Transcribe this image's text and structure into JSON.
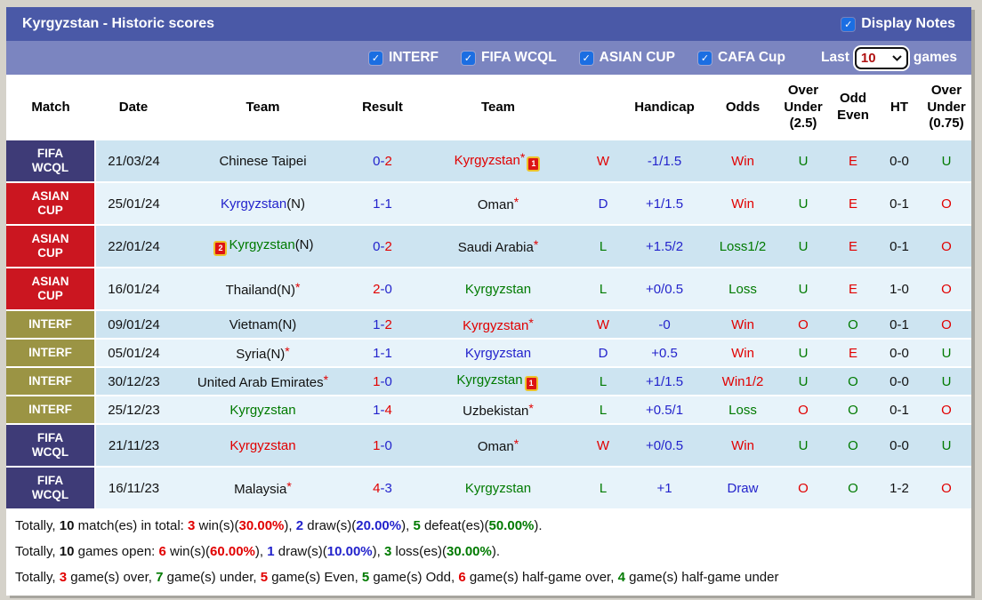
{
  "colors": {
    "red": "#e10000",
    "blue": "#2323cc",
    "green": "#007a00",
    "black": "#111111",
    "title_bar_bg": "#4a59a7",
    "filter_bar_bg": "#7b85c0",
    "row_dark": "#cde4f1",
    "row_light": "#e7f3fa",
    "comp_fifa_bg": "#3e3b77",
    "comp_asian_bg": "#cb1620",
    "comp_interf_bg": "#9b9444",
    "checkbox_blue": "#1b6ee2",
    "select_value_color": "#b01212"
  },
  "title_bar": {
    "title": "Kyrgyzstan - Historic scores",
    "display_notes_label": "Display Notes",
    "display_notes_checked": true
  },
  "filter_bar": {
    "competitions": [
      {
        "label": "INTERF",
        "checked": true
      },
      {
        "label": "FIFA WCQL",
        "checked": true
      },
      {
        "label": "ASIAN CUP",
        "checked": true
      },
      {
        "label": "CAFA Cup",
        "checked": true
      }
    ],
    "last_label": "Last",
    "selected_games": "10",
    "games_label": "games"
  },
  "table": {
    "columns": [
      "Match",
      "Date",
      "Team",
      "Result",
      "Team",
      "",
      "Handicap",
      "Odds",
      "Over Under (2.5)",
      "Odd Even",
      "HT",
      "Over Under (0.75)"
    ],
    "rows": [
      {
        "competition": "FIFA WCQL",
        "comp_key": "fifa",
        "date": "21/03/24",
        "home": {
          "name": "Chinese Taipei",
          "suffix": "",
          "color": "black",
          "star": false,
          "card": null
        },
        "score": {
          "home": "0",
          "away": "2",
          "home_color": "blue",
          "away_color": "red"
        },
        "away": {
          "name": "Kyrgyzstan",
          "suffix": "",
          "color": "red",
          "star": true,
          "card": {
            "count": "1",
            "pos": "after"
          }
        },
        "wdl": {
          "t": "W",
          "c": "red"
        },
        "handicap": "-1/1.5",
        "odds": {
          "t": "Win",
          "c": "red"
        },
        "ou25": {
          "t": "U",
          "c": "green"
        },
        "odd_even": {
          "t": "E",
          "c": "red"
        },
        "ht": "0-0",
        "ou075": {
          "t": "U",
          "c": "green"
        }
      },
      {
        "competition": "ASIAN CUP",
        "comp_key": "asian",
        "date": "25/01/24",
        "home": {
          "name": "Kyrgyzstan",
          "suffix": "(N)",
          "color": "blue",
          "star": false,
          "card": null
        },
        "score": {
          "home": "1",
          "away": "1",
          "home_color": "blue",
          "away_color": "blue"
        },
        "away": {
          "name": "Oman",
          "suffix": "",
          "color": "black",
          "star": true,
          "card": null
        },
        "wdl": {
          "t": "D",
          "c": "blue"
        },
        "handicap": "+1/1.5",
        "odds": {
          "t": "Win",
          "c": "red"
        },
        "ou25": {
          "t": "U",
          "c": "green"
        },
        "odd_even": {
          "t": "E",
          "c": "red"
        },
        "ht": "0-1",
        "ou075": {
          "t": "O",
          "c": "red"
        }
      },
      {
        "competition": "ASIAN CUP",
        "comp_key": "asian",
        "date": "22/01/24",
        "home": {
          "name": "Kyrgyzstan",
          "suffix": "(N)",
          "color": "green",
          "star": false,
          "card": {
            "count": "2",
            "pos": "before"
          }
        },
        "score": {
          "home": "0",
          "away": "2",
          "home_color": "blue",
          "away_color": "red"
        },
        "away": {
          "name": "Saudi Arabia",
          "suffix": "",
          "color": "black",
          "star": true,
          "card": null
        },
        "wdl": {
          "t": "L",
          "c": "green"
        },
        "handicap": "+1.5/2",
        "odds": {
          "t": "Loss1/2",
          "c": "green"
        },
        "ou25": {
          "t": "U",
          "c": "green"
        },
        "odd_even": {
          "t": "E",
          "c": "red"
        },
        "ht": "0-1",
        "ou075": {
          "t": "O",
          "c": "red"
        }
      },
      {
        "competition": "ASIAN CUP",
        "comp_key": "asian",
        "date": "16/01/24",
        "home": {
          "name": "Thailand",
          "suffix": "(N)",
          "color": "black",
          "star": true,
          "card": null
        },
        "score": {
          "home": "2",
          "away": "0",
          "home_color": "red",
          "away_color": "blue"
        },
        "away": {
          "name": "Kyrgyzstan",
          "suffix": "",
          "color": "green",
          "star": false,
          "card": null
        },
        "wdl": {
          "t": "L",
          "c": "green"
        },
        "handicap": "+0/0.5",
        "odds": {
          "t": "Loss",
          "c": "green"
        },
        "ou25": {
          "t": "U",
          "c": "green"
        },
        "odd_even": {
          "t": "E",
          "c": "red"
        },
        "ht": "1-0",
        "ou075": {
          "t": "O",
          "c": "red"
        }
      },
      {
        "competition": "INTERF",
        "comp_key": "interf",
        "date": "09/01/24",
        "home": {
          "name": "Vietnam",
          "suffix": "(N)",
          "color": "black",
          "star": false,
          "card": null
        },
        "score": {
          "home": "1",
          "away": "2",
          "home_color": "blue",
          "away_color": "red"
        },
        "away": {
          "name": "Kyrgyzstan",
          "suffix": "",
          "color": "red",
          "star": true,
          "card": null
        },
        "wdl": {
          "t": "W",
          "c": "red"
        },
        "handicap": "-0",
        "odds": {
          "t": "Win",
          "c": "red"
        },
        "ou25": {
          "t": "O",
          "c": "red"
        },
        "odd_even": {
          "t": "O",
          "c": "green"
        },
        "ht": "0-1",
        "ou075": {
          "t": "O",
          "c": "red"
        }
      },
      {
        "competition": "INTERF",
        "comp_key": "interf",
        "date": "05/01/24",
        "home": {
          "name": "Syria",
          "suffix": "(N)",
          "color": "black",
          "star": true,
          "card": null
        },
        "score": {
          "home": "1",
          "away": "1",
          "home_color": "blue",
          "away_color": "blue"
        },
        "away": {
          "name": "Kyrgyzstan",
          "suffix": "",
          "color": "blue",
          "star": false,
          "card": null
        },
        "wdl": {
          "t": "D",
          "c": "blue"
        },
        "handicap": "+0.5",
        "odds": {
          "t": "Win",
          "c": "red"
        },
        "ou25": {
          "t": "U",
          "c": "green"
        },
        "odd_even": {
          "t": "E",
          "c": "red"
        },
        "ht": "0-0",
        "ou075": {
          "t": "U",
          "c": "green"
        }
      },
      {
        "competition": "INTERF",
        "comp_key": "interf",
        "date": "30/12/23",
        "home": {
          "name": "United Arab Emirates",
          "suffix": "",
          "color": "black",
          "star": true,
          "card": null
        },
        "score": {
          "home": "1",
          "away": "0",
          "home_color": "red",
          "away_color": "blue"
        },
        "away": {
          "name": "Kyrgyzstan",
          "suffix": "",
          "color": "green",
          "star": false,
          "card": {
            "count": "1",
            "pos": "after"
          }
        },
        "wdl": {
          "t": "L",
          "c": "green"
        },
        "handicap": "+1/1.5",
        "odds": {
          "t": "Win1/2",
          "c": "red"
        },
        "ou25": {
          "t": "U",
          "c": "green"
        },
        "odd_even": {
          "t": "O",
          "c": "green"
        },
        "ht": "0-0",
        "ou075": {
          "t": "U",
          "c": "green"
        }
      },
      {
        "competition": "INTERF",
        "comp_key": "interf",
        "date": "25/12/23",
        "home": {
          "name": "Kyrgyzstan",
          "suffix": "",
          "color": "green",
          "star": false,
          "card": null
        },
        "score": {
          "home": "1",
          "away": "4",
          "home_color": "blue",
          "away_color": "red"
        },
        "away": {
          "name": "Uzbekistan",
          "suffix": "",
          "color": "black",
          "star": true,
          "card": null
        },
        "wdl": {
          "t": "L",
          "c": "green"
        },
        "handicap": "+0.5/1",
        "odds": {
          "t": "Loss",
          "c": "green"
        },
        "ou25": {
          "t": "O",
          "c": "red"
        },
        "odd_even": {
          "t": "O",
          "c": "green"
        },
        "ht": "0-1",
        "ou075": {
          "t": "O",
          "c": "red"
        }
      },
      {
        "competition": "FIFA WCQL",
        "comp_key": "fifa",
        "date": "21/11/23",
        "home": {
          "name": "Kyrgyzstan",
          "suffix": "",
          "color": "red",
          "star": false,
          "card": null
        },
        "score": {
          "home": "1",
          "away": "0",
          "home_color": "red",
          "away_color": "blue"
        },
        "away": {
          "name": "Oman",
          "suffix": "",
          "color": "black",
          "star": true,
          "card": null
        },
        "wdl": {
          "t": "W",
          "c": "red"
        },
        "handicap": "+0/0.5",
        "odds": {
          "t": "Win",
          "c": "red"
        },
        "ou25": {
          "t": "U",
          "c": "green"
        },
        "odd_even": {
          "t": "O",
          "c": "green"
        },
        "ht": "0-0",
        "ou075": {
          "t": "U",
          "c": "green"
        }
      },
      {
        "competition": "FIFA WCQL",
        "comp_key": "fifa",
        "date": "16/11/23",
        "home": {
          "name": "Malaysia",
          "suffix": "",
          "color": "black",
          "star": true,
          "card": null
        },
        "score": {
          "home": "4",
          "away": "3",
          "home_color": "red",
          "away_color": "blue"
        },
        "away": {
          "name": "Kyrgyzstan",
          "suffix": "",
          "color": "green",
          "star": false,
          "card": null
        },
        "wdl": {
          "t": "L",
          "c": "green"
        },
        "handicap": "+1",
        "odds": {
          "t": "Draw",
          "c": "blue"
        },
        "ou25": {
          "t": "O",
          "c": "red"
        },
        "odd_even": {
          "t": "O",
          "c": "green"
        },
        "ht": "1-2",
        "ou075": {
          "t": "O",
          "c": "red"
        }
      }
    ]
  },
  "summary_lines": [
    [
      {
        "t": "Totally, ",
        "c": "black",
        "b": false
      },
      {
        "t": "10",
        "c": "black",
        "b": true
      },
      {
        "t": " match(es) in total: ",
        "c": "black",
        "b": false
      },
      {
        "t": "3",
        "c": "red",
        "b": true
      },
      {
        "t": " win(s)(",
        "c": "black",
        "b": false
      },
      {
        "t": "30.00%",
        "c": "red",
        "b": true
      },
      {
        "t": "), ",
        "c": "black",
        "b": false
      },
      {
        "t": "2",
        "c": "blue",
        "b": true
      },
      {
        "t": " draw(s)(",
        "c": "black",
        "b": false
      },
      {
        "t": "20.00%",
        "c": "blue",
        "b": true
      },
      {
        "t": "), ",
        "c": "black",
        "b": false
      },
      {
        "t": "5",
        "c": "green",
        "b": true
      },
      {
        "t": " defeat(es)(",
        "c": "black",
        "b": false
      },
      {
        "t": "50.00%",
        "c": "green",
        "b": true
      },
      {
        "t": ").",
        "c": "black",
        "b": false
      }
    ],
    [
      {
        "t": "Totally, ",
        "c": "black",
        "b": false
      },
      {
        "t": "10",
        "c": "black",
        "b": true
      },
      {
        "t": " games open: ",
        "c": "black",
        "b": false
      },
      {
        "t": "6",
        "c": "red",
        "b": true
      },
      {
        "t": " win(s)(",
        "c": "black",
        "b": false
      },
      {
        "t": "60.00%",
        "c": "red",
        "b": true
      },
      {
        "t": "), ",
        "c": "black",
        "b": false
      },
      {
        "t": "1",
        "c": "blue",
        "b": true
      },
      {
        "t": " draw(s)(",
        "c": "black",
        "b": false
      },
      {
        "t": "10.00%",
        "c": "blue",
        "b": true
      },
      {
        "t": "), ",
        "c": "black",
        "b": false
      },
      {
        "t": "3",
        "c": "green",
        "b": true
      },
      {
        "t": " loss(es)(",
        "c": "black",
        "b": false
      },
      {
        "t": "30.00%",
        "c": "green",
        "b": true
      },
      {
        "t": ").",
        "c": "black",
        "b": false
      }
    ],
    [
      {
        "t": "Totally, ",
        "c": "black",
        "b": false
      },
      {
        "t": "3",
        "c": "red",
        "b": true
      },
      {
        "t": " game(s) over, ",
        "c": "black",
        "b": false
      },
      {
        "t": "7",
        "c": "green",
        "b": true
      },
      {
        "t": " game(s) under, ",
        "c": "black",
        "b": false
      },
      {
        "t": "5",
        "c": "red",
        "b": true
      },
      {
        "t": " game(s) Even, ",
        "c": "black",
        "b": false
      },
      {
        "t": "5",
        "c": "green",
        "b": true
      },
      {
        "t": " game(s) Odd, ",
        "c": "black",
        "b": false
      },
      {
        "t": "6",
        "c": "red",
        "b": true
      },
      {
        "t": " game(s) half-game over, ",
        "c": "black",
        "b": false
      },
      {
        "t": "4",
        "c": "green",
        "b": true
      },
      {
        "t": " game(s) half-game under",
        "c": "black",
        "b": false
      }
    ]
  ]
}
